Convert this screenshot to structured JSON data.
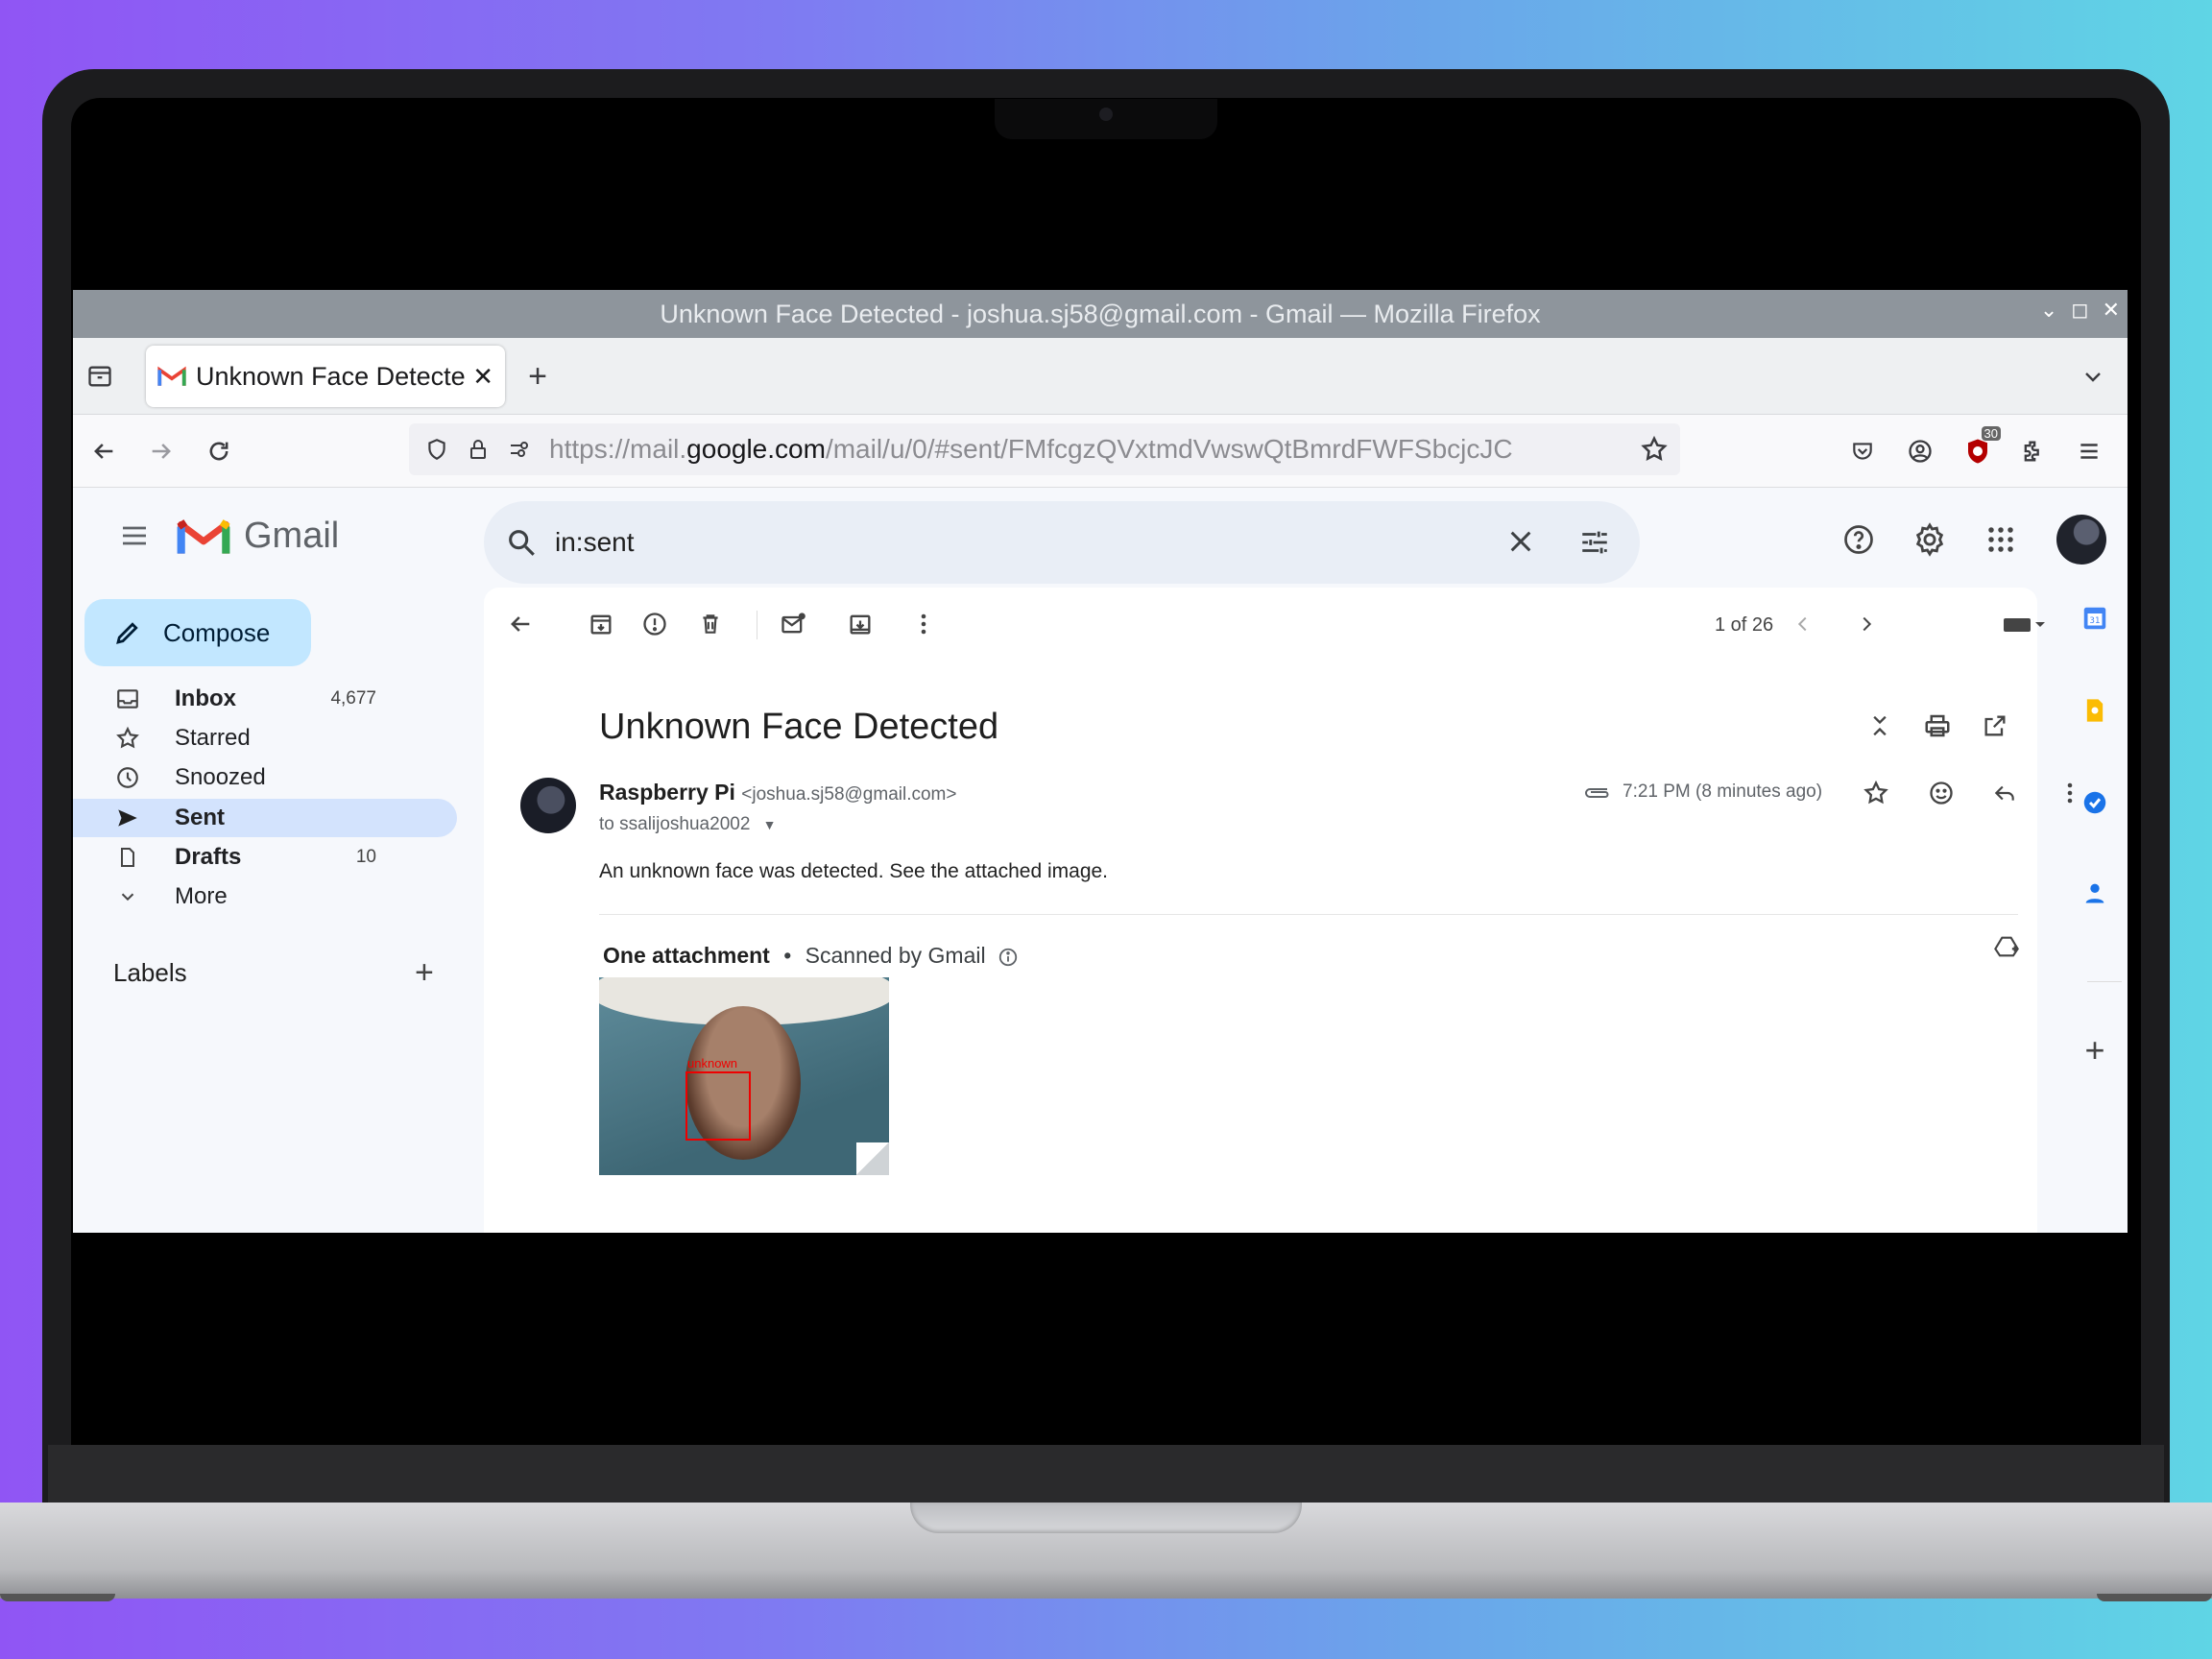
{
  "window": {
    "title": "Unknown Face Detected - joshua.sj58@gmail.com - Gmail — Mozilla Firefox"
  },
  "browser": {
    "tab_title": "Unknown Face Detecte",
    "url_prefix": "https://mail.",
    "url_domain": "google.com",
    "url_path": "/mail/u/0/#sent/FMfcgzQVxtmdVwswQtBmrdFWFSbcjcJC",
    "ext_badge": "30"
  },
  "gmail": {
    "brand": "Gmail",
    "search_value": "in:sent",
    "compose_label": "Compose",
    "nav": [
      {
        "label": "Inbox",
        "count": "4,677"
      },
      {
        "label": "Starred",
        "count": ""
      },
      {
        "label": "Snoozed",
        "count": ""
      },
      {
        "label": "Sent",
        "count": ""
      },
      {
        "label": "Drafts",
        "count": "10"
      },
      {
        "label": "More",
        "count": ""
      }
    ],
    "labels_heading": "Labels",
    "pager": "1 of 26"
  },
  "message": {
    "subject": "Unknown Face Detected",
    "sender_name": "Raspberry Pi",
    "sender_email": "<joshua.sj58@gmail.com>",
    "to": "to ssalijoshua2002",
    "time": "7:21 PM (8 minutes ago)",
    "body": "An unknown face was detected. See the attached image.",
    "attachment_heading": "One attachment",
    "attachment_scan": "Scanned by Gmail",
    "image_label": "unknown"
  },
  "colors": {
    "accent": "#c2e7ff",
    "active_nav": "#d3e3fd",
    "gmail_red": "#ea4335"
  }
}
